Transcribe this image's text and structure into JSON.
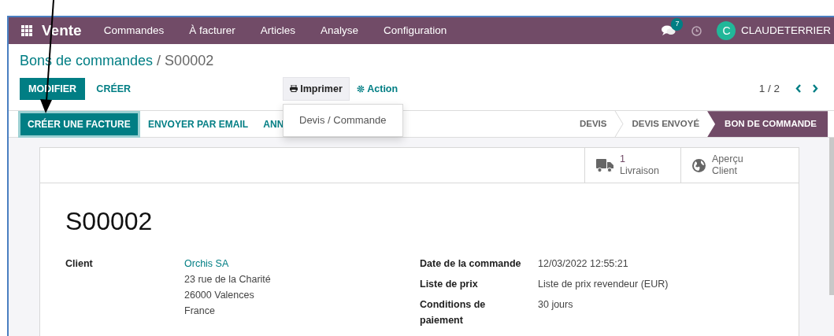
{
  "navbar": {
    "app_name": "Vente",
    "menu": [
      "Commandes",
      "À facturer",
      "Articles",
      "Analyse",
      "Configuration"
    ],
    "messages_badge": "7",
    "avatar_initial": "C",
    "user": "CLAUDETERRIER"
  },
  "breadcrumb": {
    "parent": "Bons de commandes",
    "separator": "/",
    "current": "S00002"
  },
  "control_buttons": [
    {
      "label": "MODIFIER",
      "kind": "primary"
    },
    {
      "label": "CRÉER",
      "kind": "link"
    }
  ],
  "print_button": {
    "label": "Imprimer",
    "expanded": true
  },
  "action_button": {
    "label": "Action"
  },
  "print_menu": [
    "Devis / Commande"
  ],
  "pager": "1 / 2",
  "header_buttons": [
    {
      "label": "CRÉER UNE FACTURE",
      "kind": "primary"
    },
    {
      "label": "ENVOYER PAR EMAIL",
      "kind": "link"
    },
    {
      "label": "ANN",
      "kind": "link"
    }
  ],
  "status_steps": [
    {
      "label": "DEVIS",
      "selected": false
    },
    {
      "label": "DEVIS ENVOYÉ",
      "selected": false
    },
    {
      "label": "BON DE COMMANDE",
      "selected": true
    }
  ],
  "smart_buttons": [
    {
      "kind": "delivery",
      "count": "1",
      "label": "Livraison"
    },
    {
      "kind": "preview",
      "label": "Aperçu Client"
    }
  ],
  "title": "S00002",
  "left_fields": [
    {
      "label": "Client",
      "link": "Orchis SA",
      "lines": [
        "23 rue de la Charité",
        "26000 Valences",
        "France"
      ]
    }
  ],
  "right_fields": [
    {
      "label": "Date de la commande",
      "value": "12/03/2022 12:55:21"
    },
    {
      "label": "Liste de prix",
      "value": "Liste de prix revendeur (EUR)"
    },
    {
      "label": "Conditions de paiement",
      "value": "30 jours"
    }
  ]
}
